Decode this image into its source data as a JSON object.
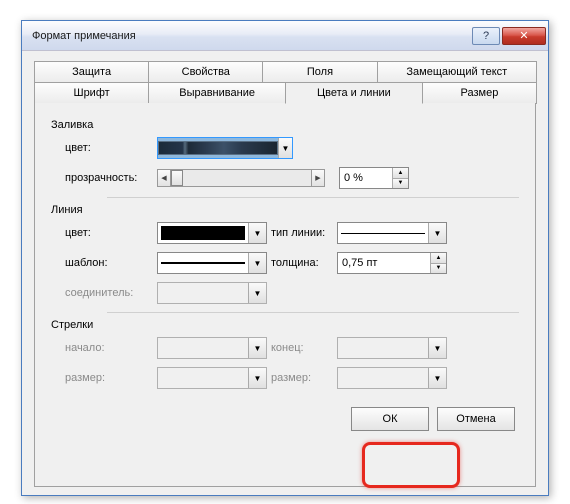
{
  "title": "Формат примечания",
  "tabs_row1": [
    "Защита",
    "Свойства",
    "Поля",
    "Замещающий текст"
  ],
  "tabs_row2": [
    "Шрифт",
    "Выравнивание",
    "Цвета и линии",
    "Размер"
  ],
  "active_tab": "Цвета и линии",
  "fill": {
    "group": "Заливка",
    "color_label": "цвет:",
    "transparency_label": "прозрачность:",
    "transparency_value": "0 %"
  },
  "line": {
    "group": "Линия",
    "color_label": "цвет:",
    "pattern_label": "шаблон:",
    "connector_label": "соединитель:",
    "type_label": "тип линии:",
    "thickness_label": "толщина:",
    "thickness_value": "0,75 пт"
  },
  "arrows": {
    "group": "Стрелки",
    "begin_label": "начало:",
    "end_label": "конец:",
    "size1_label": "размер:",
    "size2_label": "размер:"
  },
  "buttons": {
    "ok": "ОК",
    "cancel": "Отмена"
  }
}
